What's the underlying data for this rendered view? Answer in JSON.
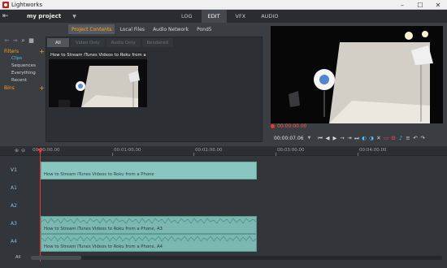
{
  "window": {
    "title": "Lightworks",
    "minimize": "–",
    "maximize": "☐",
    "close": "✕"
  },
  "header": {
    "project_name": "my project",
    "tabs": [
      "LOG",
      "EDIT",
      "VFX",
      "AUDIO"
    ],
    "active_tab": "EDIT"
  },
  "content_tabs": [
    "Project Contents",
    "Local Files",
    "Audio Network",
    "Pond5"
  ],
  "filter_tabs": [
    "All",
    "Video Only",
    "Audio Only",
    "Rendered"
  ],
  "sidebar": {
    "filters_label": "Filters",
    "filters": [
      "Clips",
      "Sequences",
      "Everything",
      "Recent"
    ],
    "bins_label": "Bins"
  },
  "clip": {
    "title": "How to Stream iTunes Videos to Roku from a"
  },
  "viewer": {
    "top_time": "00:00:00.00",
    "timecode": "00:00:07.06"
  },
  "timeline": {
    "ruler": [
      "00:00:00.00",
      "00:01:00.00",
      "00:02:00.00",
      "00:03:00.00",
      "00:04:00.00"
    ],
    "tracks": [
      "V1",
      "A1",
      "A2",
      "A3",
      "A4"
    ],
    "video_clip_name": "How to Stream iTunes Videos to Roku from a Phone",
    "audio_clip_a3": "How to Stream iTunes Videos to Roku from a Phone, A3",
    "audio_clip_a4": "How to Stream iTunes Videos to Roku from a Phone, A4",
    "all_label": "All"
  },
  "colors": {
    "accent": "#ff9e1b",
    "clip": "#8ac6c0",
    "playhead": "#e53935"
  }
}
